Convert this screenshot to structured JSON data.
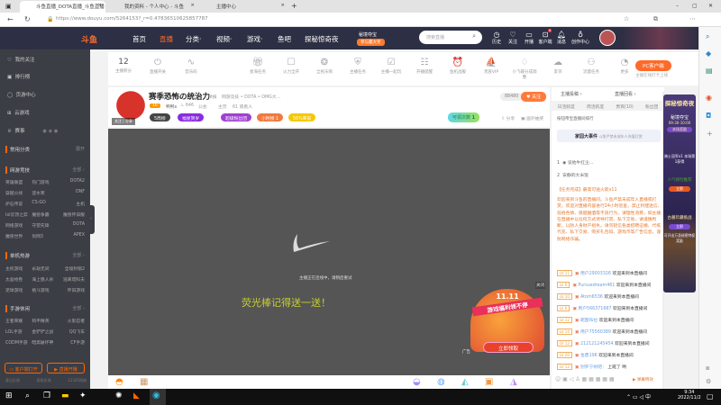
{
  "browser": {
    "tabs": [
      {
        "title": "斗鱼直播_DOTA直播_斗鱼直播",
        "active": true
      },
      {
        "title": "我的资料 - 个人中心 - 斗鱼",
        "active": false
      },
      {
        "title": "主播中心",
        "active": false
      }
    ],
    "url": "https://www.douyu.com/5264153?_r=0.47836510625857787",
    "new_tab": "+",
    "window": {
      "min": "–",
      "max": "▢",
      "close": "✕"
    }
  },
  "nav": {
    "logo": "斗鱼",
    "items": [
      "首页",
      "直播",
      "分类·",
      "视频·",
      "游戏·",
      "鱼吧",
      "探秘惊奇夜"
    ],
    "active": 1,
    "promo": "秘境夺宝",
    "promo_sub": "参与赢大奖",
    "search_placeholder": "搜索直播",
    "icons": [
      {
        "label": "历史",
        "icon": "clock-icon"
      },
      {
        "label": "关注",
        "icon": "heart-icon"
      },
      {
        "label": "开播",
        "icon": "camera-icon"
      },
      {
        "label": "客户端",
        "icon": "client-icon",
        "badge": "9"
      },
      {
        "label": "消息",
        "icon": "bell-icon"
      },
      {
        "label": "创作中心",
        "icon": "bulb-icon"
      }
    ]
  },
  "sidebar": {
    "items": [
      "我的关注",
      "排行榜",
      "页游中心",
      "云游戏",
      "赛事"
    ],
    "common": {
      "title": "常用分类",
      "more": "展开"
    },
    "sections": [
      {
        "title": "网游竞技",
        "more": "全部 ›",
        "games": [
          "英雄联盟",
          "热门游戏",
          "DOTA2",
          "穿越火线",
          "逆水寒",
          "DNF",
          "炉石传说",
          "CS:GO",
          "主机",
          "lol云顶之弈",
          "魔兽争霸",
          "魔兽怀旧服",
          "网络游戏",
          "守望先锋",
          "DOTA",
          "魔兽世界",
          "剑网3",
          "APEX"
        ]
      },
      {
        "title": "单机热游",
        "more": "全部 ›",
        "games": [
          "主机游戏",
          "永劫无间",
          "全境封锁2",
          "太吾绘卷",
          "海上狼人杀",
          "逃离塔科夫",
          "足球游戏",
          "格斗游戏",
          "怀旧游戏"
        ]
      },
      {
        "title": "手游休闲",
        "more": "全部 ›",
        "games": [
          "王者荣耀",
          "和平精英",
          "火影忍者",
          "LOL手游",
          "金铲铲之战",
          "QQ飞车",
          "CODM手游",
          "暗黑破坏神",
          "CF手游"
        ]
      }
    ],
    "buttons": [
      "客户端打开",
      "直播开播"
    ],
    "footer": [
      "意见反馈",
      "帮助反馈",
      "12345网络"
    ]
  },
  "toolbar": {
    "count": "12",
    "count_label": "主播积分",
    "items": [
      "直播开关",
      "音乐码",
      "",
      "星海任务",
      "火力全开",
      "全民乐购",
      "主播任务",
      "主播一起玩",
      "开播提醒",
      "鱼机战舰",
      "贵族VIP",
      "小飞碟分成调整",
      "友邻",
      "流量任务",
      "更多"
    ],
    "pc_button": "PC客户端",
    "pc_sub": "主播在线打卡上线"
  },
  "room": {
    "title": "赛季恐怖の统治力",
    "tag": "举报",
    "category": "网游竞技 • DOTA • OMG大...",
    "level": "16",
    "anchor": "鸭鸭s",
    "hot": "646",
    "notice": "公会",
    "report": "主页",
    "viewers": "61 观看人",
    "follow_count": "88480",
    "follow": "关注",
    "badges": [
      "5周榜",
      "福星贺岁",
      "超级粉丝团",
      "小时榜 1",
      "56%荣誉"
    ],
    "task": "可领次数",
    "task_count": "1",
    "share": "分享",
    "window": "画外抽奖",
    "avatar_btns": [
      "关注",
      "分享"
    ]
  },
  "video": {
    "status": "主播正在连线中，请稍后重试",
    "caption": "荧光棒记得送一送！",
    "ad_title": "11.11",
    "ad_text": "游戏福利领不停",
    "ad_button": "立即领取",
    "ad_label": "广告",
    "close": "关闭"
  },
  "chat": {
    "top": [
      "主播投稿 ›",
      "直播回看 ›"
    ],
    "tabs": [
      "日活跃度",
      "周活跃度",
      "贵宾(10)",
      "粉丝团"
    ],
    "rank_title": "按钮帝宝直播间排行",
    "event": "家园大事件",
    "event_desc": "斗鱼严禁未成年人充值打赏",
    "ranks": [
      {
        "n": "1",
        "name": "谈他牛红尘..."
      },
      {
        "n": "2",
        "name": "安静的大米饭"
      }
    ],
    "system": [
      "【任务完成】最高可送火箭x11",
      "欢迎来到斗鱼的直播间。斗鱼严禁未成年人直播或打赏，欢迎对直播内容进行24小时巡查，禁止封建迷信、低俗色情、吸烟酗酒等不良行为，请理性消费，如主播在直播中以任何方式诱导打赏、私下交易，请谨慎判断，以防人身财产损失。请勿轻信各类招聘征婚、代练代充、私下交易、购买礼包码、游戏币等广告信息，谨防网络诈骗。"
    ],
    "messages": [
      {
        "lv": "LV 11",
        "user": "用户29003326",
        "text": "欢迎来到本直播间"
      },
      {
        "lv": "LV 6",
        "user": "Pursuedream461",
        "text": "欢迎来到本直播间"
      },
      {
        "lv": "LV 10",
        "user": "Atom6536",
        "text": "欢迎来到本直播间"
      },
      {
        "lv": "LV 6",
        "user": "用户566371687",
        "text": "欢迎来到本直播间"
      },
      {
        "lv": "LV 12",
        "user": "昵图布拉",
        "text": "欢迎来到本直播间"
      },
      {
        "lv": "LV 14",
        "user": "用户75560389",
        "text": "欢迎来到本直播间"
      },
      {
        "lv": "LV 12",
        "user": "212121245454",
        "text": "欢迎来到本直播间"
      },
      {
        "lv": "LV 20",
        "user": "金鼎196",
        "text": "欢迎来到本直播间"
      },
      {
        "lv": "LV 12",
        "user": "别罗宁树吧：",
        "text": "上班了 哟"
      }
    ],
    "input_hint": "弹幕特效"
  },
  "ad": {
    "title": "探秘惊奇夜",
    "sub": "秘境夺宝",
    "time": "09:30-10:00",
    "btn": "本场奖励",
    "prize": "骑士冠军x1 本场第1获得",
    "box": "人气探险推荐",
    "btn2": "立即",
    "box2": "古墓珍藏挑战",
    "btn3": "立即",
    "foot": "可开出万圣秘密特权奖励"
  },
  "taskbar": {
    "time": "9:34",
    "date": "2022/11/2",
    "ime": "中"
  }
}
